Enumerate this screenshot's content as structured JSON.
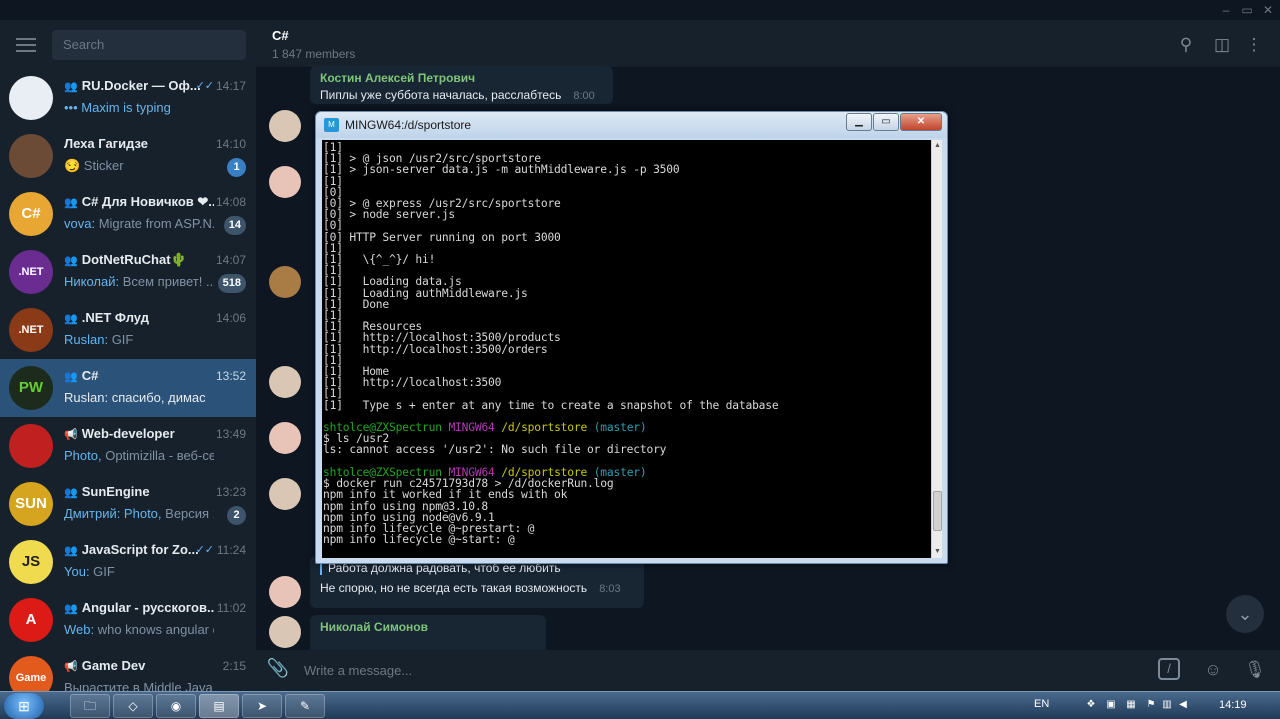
{
  "window": {
    "controls": [
      "–",
      "▭",
      "✕"
    ]
  },
  "sidebar": {
    "search_placeholder": "Search",
    "chats": [
      {
        "name": "RU.Docker — Оф...",
        "time": "14:17",
        "preview_sender": "",
        "preview": "••• Maxim is typing",
        "badge": "",
        "avatar_text": "",
        "avatar_color": "#e8eef3",
        "group_icon": "group-icon",
        "read": true
      },
      {
        "name": "Леха Гагидзе",
        "time": "14:10",
        "preview_sender": "",
        "preview": "😏 Sticker",
        "badge": "1",
        "avatar_text": "",
        "avatar_color": "#6b4a36",
        "group_icon": "",
        "read": false
      },
      {
        "name": "C# Для Новичков ❤...",
        "time": "14:08",
        "preview_sender": "vova:",
        "preview": " Migrate from ASP.N...",
        "badge": "14",
        "avatar_text": "C#",
        "avatar_color": "#e8a733",
        "group_icon": "group-icon",
        "read": false
      },
      {
        "name": "DotNetRuChat🌵",
        "time": "14:07",
        "preview_sender": "Николай:",
        "preview": " Всем привет! ...",
        "badge": "518",
        "avatar_text": ".NET",
        "avatar_color": "#6a2c91",
        "group_icon": "group-icon",
        "read": false
      },
      {
        "name": ".NET Флуд",
        "time": "14:06",
        "preview_sender": "Ruslan:",
        "preview": " GIF",
        "badge": "",
        "avatar_text": ".NET",
        "avatar_color": "#8a3a17",
        "group_icon": "group-icon",
        "read": false
      },
      {
        "name": "C#",
        "time": "13:52",
        "preview_sender": "Ruslan:",
        "preview": " спасибо, димас",
        "badge": "",
        "avatar_text": "PW",
        "avatar_color": "#1c2b1c",
        "group_icon": "group-icon",
        "read": false
      },
      {
        "name": "Web-developer",
        "time": "13:49",
        "preview_sender": "Photo,",
        "preview": " Optimizilla - веб-сервис...",
        "badge": "",
        "avatar_text": "",
        "avatar_color": "#c02020",
        "group_icon": "megaphone-icon",
        "read": false
      },
      {
        "name": "SunEngine",
        "time": "13:23",
        "preview_sender": "Дмитрий: Photo,",
        "preview": " Версия 1...",
        "badge": "2",
        "avatar_text": "SUN",
        "avatar_color": "#d6a520",
        "group_icon": "group-icon",
        "read": false
      },
      {
        "name": "JavaScript for Zo...",
        "time": "11:24",
        "preview_sender": "You:",
        "preview": " GIF",
        "badge": "",
        "avatar_text": "JS",
        "avatar_color": "#f0db4f",
        "group_icon": "group-icon",
        "read": true
      },
      {
        "name": "Angular - русскогов...",
        "time": "11:02",
        "preview_sender": "Web:",
        "preview": " who knows angular dart?",
        "badge": "",
        "avatar_text": "A",
        "avatar_color": "#dd1b16",
        "group_icon": "group-icon",
        "read": false
      },
      {
        "name": "Game Dev",
        "time": "2:15",
        "preview_sender": "",
        "preview": "Вырастите в Middle Java De...",
        "badge": "",
        "avatar_text": "Game Dev",
        "avatar_color": "#e25a1c",
        "group_icon": "megaphone-icon",
        "read": false
      }
    ]
  },
  "header": {
    "title": "C#",
    "members": "1 847 members"
  },
  "messages": {
    "top_author": "Костин Алексей Петрович",
    "top_text": "Пиплы уже суббота началась, расслабтесь",
    "top_time": "8:00",
    "quote_text": "Работа должна радовать, чтоб ее любить",
    "reply_text": "Не спорю, но не всегда есть такая возможность",
    "reply_time": "8:03",
    "bottom_author": "Николай Симонов"
  },
  "compose": {
    "placeholder": "Write a message..."
  },
  "terminal": {
    "title": "MINGW64:/d/sportstore",
    "lines": [
      "[1]",
      "[1] > @ json /usr2/src/sportstore",
      "[1] > json-server data.js -m authMiddleware.js -p 3500",
      "[1]",
      "[0]",
      "[0] > @ express /usr2/src/sportstore",
      "[0] > node server.js",
      "[0]",
      "[0] HTTP Server running on port 3000",
      "[1]",
      "[1]   \\{^_^}/ hi!",
      "[1]",
      "[1]   Loading data.js",
      "[1]   Loading authMiddleware.js",
      "[1]   Done",
      "[1]",
      "[1]   Resources",
      "[1]   http://localhost:3500/products",
      "[1]   http://localhost:3500/orders",
      "[1]",
      "[1]   Home",
      "[1]   http://localhost:3500",
      "[1]",
      "[1]   Type s + enter at any time to create a snapshot of the database"
    ],
    "prompt_user": "shtolce@ZXSpectrun",
    "prompt_mingw": "MINGW64",
    "prompt_path": "/d/sportstore",
    "prompt_branch": "(master)",
    "cmd1": "$ ls /usr2",
    "cmd1_out": "ls: cannot access '/usr2': No such file or directory",
    "cmd2": "$ docker run c24571793d78 > /d/dockerRun.log",
    "cmd2_out": [
      "npm info it worked if it ends with ok",
      "npm info using npm@3.10.8",
      "npm info using node@v6.9.1",
      "npm info lifecycle @~prestart: @",
      "npm info lifecycle @~start: @"
    ]
  },
  "taskbar": {
    "lang": "EN",
    "clock": "14:19"
  }
}
